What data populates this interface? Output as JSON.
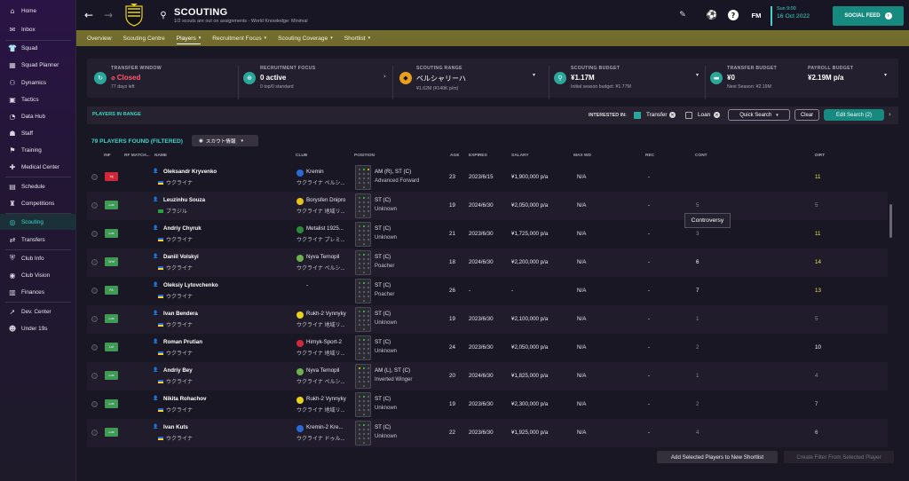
{
  "sidebar": {
    "items": [
      "Home",
      "Inbox",
      "Squad",
      "Squad Planner",
      "Dynamics",
      "Tactics",
      "Data Hub",
      "Staff",
      "Training",
      "Medical Center",
      "Schedule",
      "Competitions",
      "Scouting",
      "Transfers",
      "Club Info",
      "Club Vision",
      "Finances",
      "Dev. Center",
      "Under 19s"
    ]
  },
  "header": {
    "title": "SCOUTING",
    "subtitle": "1/2 scouts are out on assignments - World Knowledge: Minimal",
    "day": "Sun 9:00",
    "date": "16 Oct 2022",
    "fm": "FM",
    "social_feed": "SOCIAL FEED",
    "tabs": [
      "Overview",
      "Scouting Centre",
      "Players",
      "Recruitment Focus",
      "Scouting Coverage",
      "Shortlist"
    ]
  },
  "info": {
    "transfer_window": {
      "label": "TRANSFER WINDOW",
      "value": "Closed",
      "sub": "77 days left"
    },
    "recruitment_focus": {
      "label": "RECRUITMENT FOCUS",
      "value": "0 active",
      "sub": "0 top/0 standard"
    },
    "scouting_range": {
      "label": "SCOUTING RANGE",
      "value": "ベルシャリーハ",
      "sub": "¥1.62M (¥140K p/m)"
    },
    "scouting_budget": {
      "label": "SCOUTING BUDGET",
      "value": "¥1.17M",
      "sub": "Initial season budget: ¥1.77M"
    },
    "transfer_budget": {
      "label": "TRANSFER BUDGET",
      "value": "¥0",
      "sub": "Next Season: ¥2.19M"
    },
    "payroll_budget": {
      "label": "PAYROLL BUDGET",
      "value": "¥2.19M p/a"
    }
  },
  "filter": {
    "players_in_range": "PLAYERS IN RANGE",
    "interested_in": "INTERESTED IN:",
    "transfer": "Transfer",
    "loan": "Loan",
    "quick_search": "Quick Search",
    "clear": "Clear",
    "edit_search": "Edit Search (2)"
  },
  "results": {
    "found": "79 PLAYERS FOUND (FILTERED)",
    "view": "スカウト情報"
  },
  "columns": [
    "INF",
    "RF MATCH",
    "NAME",
    "CLUB",
    "POSITION",
    "AGE",
    "EXPIRES",
    "SALARY",
    "MAX WD",
    "REC",
    "CONT",
    "DIRT"
  ],
  "rows": [
    {
      "inf": "Inj",
      "name": "Oleksandr Kryvenko",
      "nat": "ウクライナ",
      "club": "Kremin",
      "club2": "ウクライナ ペルシ...",
      "pos": "AM (R), ST (C)",
      "role": "Advanced Forward",
      "age": "23",
      "expires": "2023/6/15",
      "salary": "¥1,900,000 p/a",
      "maxwd": "N/A",
      "rec": "-",
      "cont": "",
      "dirt": "11"
    },
    {
      "inf": "Loa",
      "name": "Leuzinhu Souza",
      "nat": "ブラジル",
      "club": "Borysfen Dnipro",
      "club2": "ウクライナ 地域リ...",
      "pos": "ST (C)",
      "role": "Unknown",
      "age": "19",
      "expires": "2024/6/30",
      "salary": "¥2,050,000 p/a",
      "maxwd": "N/A",
      "rec": "-",
      "cont": "5",
      "dirt": "5"
    },
    {
      "inf": "Loa",
      "name": "Andriy Chyruk",
      "nat": "ウクライナ",
      "club": "Metalist 1925...",
      "club2": "ウクライナ プレミ...",
      "pos": "ST (C)",
      "role": "Unknown",
      "age": "21",
      "expires": "2023/6/30",
      "salary": "¥1,725,000 p/a",
      "maxwd": "N/A",
      "rec": "-",
      "cont": "3",
      "dirt": "11"
    },
    {
      "inf": "Wnt",
      "name": "Daniil Volskyi",
      "nat": "ウクライナ",
      "club": "Nyva Ternopil",
      "club2": "ウクライナ ペルシ...",
      "pos": "ST (C)",
      "role": "Poacher",
      "age": "18",
      "expires": "2024/6/30",
      "salary": "¥2,200,000 p/a",
      "maxwd": "N/A",
      "rec": "-",
      "cont": "6",
      "dirt": "14"
    },
    {
      "inf": "FA",
      "name": "Oleksiy Lytovchenko",
      "nat": "ウクライナ",
      "club": "-",
      "club2": "",
      "pos": "ST (C)",
      "role": "Poacher",
      "age": "26",
      "expires": "-",
      "salary": "-",
      "maxwd": "N/A",
      "rec": "-",
      "cont": "7",
      "dirt": "13"
    },
    {
      "inf": "Loa",
      "name": "Ivan Bendera",
      "nat": "ウクライナ",
      "club": "Rukh-2 Vynnyky",
      "club2": "ウクライナ 地域リ...",
      "pos": "ST (C)",
      "role": "Unknown",
      "age": "19",
      "expires": "2023/6/30",
      "salary": "¥2,100,000 p/a",
      "maxwd": "N/A",
      "rec": "-",
      "cont": "1",
      "dirt": "5"
    },
    {
      "inf": "Lst",
      "name": "Roman Prutian",
      "nat": "ウクライナ",
      "club": "Hirnyk-Sport-2",
      "club2": "ウクライナ 地域リ...",
      "pos": "ST (C)",
      "role": "Unknown",
      "age": "24",
      "expires": "2023/6/30",
      "salary": "¥2,050,000 p/a",
      "maxwd": "N/A",
      "rec": "-",
      "cont": "2",
      "dirt": "10"
    },
    {
      "inf": "Loa",
      "name": "Andriy Bey",
      "nat": "ウクライナ",
      "club": "Nyva Ternopil",
      "club2": "ウクライナ ペルシ...",
      "pos": "AM (L), ST (C)",
      "role": "Inverted Winger",
      "age": "20",
      "expires": "2024/6/30",
      "salary": "¥1,825,000 p/a",
      "maxwd": "N/A",
      "rec": "-",
      "cont": "1",
      "dirt": "4"
    },
    {
      "inf": "Loa",
      "name": "Nikita Rohachov",
      "nat": "ウクライナ",
      "club": "Rukh-2 Vynnyky",
      "club2": "ウクライナ 地域リ...",
      "pos": "ST (C)",
      "role": "Unknown",
      "age": "19",
      "expires": "2023/6/30",
      "salary": "¥2,300,000 p/a",
      "maxwd": "N/A",
      "rec": "-",
      "cont": "2",
      "dirt": "7"
    },
    {
      "inf": "Loa",
      "name": "Ivan Kuts",
      "nat": "ウクライナ",
      "club": "Kremin-2 Kre...",
      "club2": "ウクライナ ドゥル...",
      "pos": "ST (C)",
      "role": "Unknown",
      "age": "22",
      "expires": "2023/6/30",
      "salary": "¥1,925,000 p/a",
      "maxwd": "N/A",
      "rec": "-",
      "cont": "4",
      "dirt": "6"
    }
  ],
  "tooltip": "Controversy",
  "bottom": {
    "add_shortlist": "Add Selected Players to New Shortlist",
    "create_filter": "Create Filter From Selected Player"
  },
  "colors": {
    "accent": "#3fd6c8",
    "header_bar": "#7d7834",
    "social": "#178a80"
  }
}
